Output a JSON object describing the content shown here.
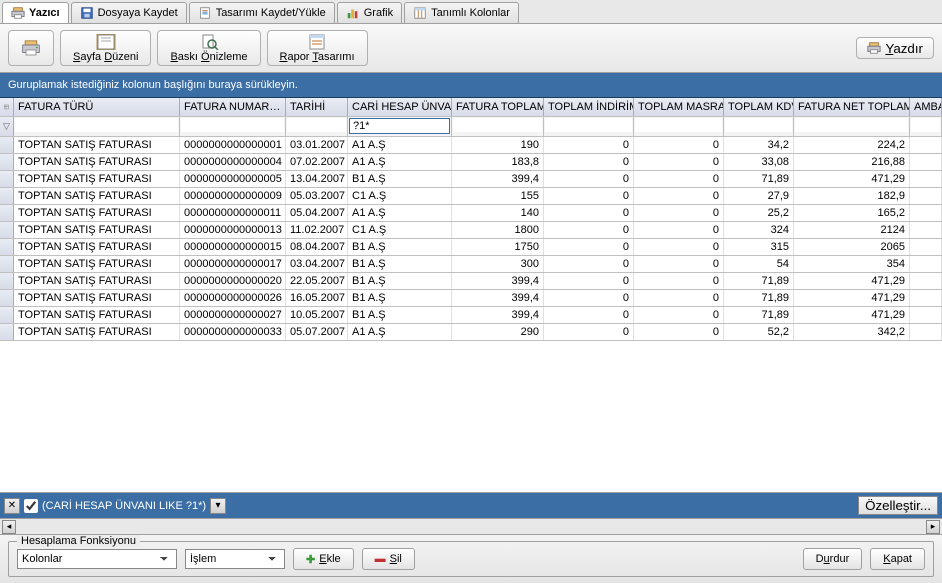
{
  "tabs": [
    {
      "label": "Yazıcı",
      "icon": "printer"
    },
    {
      "label": "Dosyaya Kaydet",
      "icon": "save"
    },
    {
      "label": "Tasarımı Kaydet/Yükle",
      "icon": "report"
    },
    {
      "label": "Grafik",
      "icon": "chart"
    },
    {
      "label": "Tanımlı Kolonlar",
      "icon": "columns"
    }
  ],
  "toolbar": {
    "print_icon": "printer",
    "page_layout": "Sayfa Düzeni",
    "preview": "Baskı Önizleme",
    "report_design": "Rapor Tasarımı",
    "print_btn": "Yazdır"
  },
  "group_text": "Guruplamak istediğiniz kolonun başlığını buraya sürükleyin.",
  "columns": [
    "FATURA TÜRÜ",
    "FATURA NUMAR…",
    "TARİHİ",
    "CARİ HESAP ÜNVANI",
    "FATURA TOPLAMI",
    "TOPLAM İNDİRİM",
    "TOPLAM MASRAF",
    "TOPLAM KDV",
    "FATURA NET TOPLAMI",
    "AMBA"
  ],
  "filter_values": {
    "cari": "?1*"
  },
  "rows": [
    {
      "type": "TOPTAN SATIŞ FATURASI",
      "num": "0000000000000001",
      "date": "03.01.2007",
      "cari": "A1 A.Ş",
      "tot": "190",
      "ind": "0",
      "mas": "0",
      "kdv": "34,2",
      "net": "224,2"
    },
    {
      "type": "TOPTAN SATIŞ FATURASI",
      "num": "0000000000000004",
      "date": "07.02.2007",
      "cari": "A1 A.Ş",
      "tot": "183,8",
      "ind": "0",
      "mas": "0",
      "kdv": "33,08",
      "net": "216,88"
    },
    {
      "type": "TOPTAN SATIŞ FATURASI",
      "num": "0000000000000005",
      "date": "13.04.2007",
      "cari": "B1 A.Ş",
      "tot": "399,4",
      "ind": "0",
      "mas": "0",
      "kdv": "71,89",
      "net": "471,29"
    },
    {
      "type": "TOPTAN SATIŞ FATURASI",
      "num": "0000000000000009",
      "date": "05.03.2007",
      "cari": "C1 A.Ş",
      "tot": "155",
      "ind": "0",
      "mas": "0",
      "kdv": "27,9",
      "net": "182,9"
    },
    {
      "type": "TOPTAN SATIŞ FATURASI",
      "num": "0000000000000011",
      "date": "05.04.2007",
      "cari": "A1 A.Ş",
      "tot": "140",
      "ind": "0",
      "mas": "0",
      "kdv": "25,2",
      "net": "165,2"
    },
    {
      "type": "TOPTAN SATIŞ FATURASI",
      "num": "0000000000000013",
      "date": "11.02.2007",
      "cari": "C1 A.Ş",
      "tot": "1800",
      "ind": "0",
      "mas": "0",
      "kdv": "324",
      "net": "2124"
    },
    {
      "type": "TOPTAN SATIŞ FATURASI",
      "num": "0000000000000015",
      "date": "08.04.2007",
      "cari": "B1 A.Ş",
      "tot": "1750",
      "ind": "0",
      "mas": "0",
      "kdv": "315",
      "net": "2065"
    },
    {
      "type": "TOPTAN SATIŞ FATURASI",
      "num": "0000000000000017",
      "date": "03.04.2007",
      "cari": "B1 A.Ş",
      "tot": "300",
      "ind": "0",
      "mas": "0",
      "kdv": "54",
      "net": "354"
    },
    {
      "type": "TOPTAN SATIŞ FATURASI",
      "num": "0000000000000020",
      "date": "22.05.2007",
      "cari": "B1 A.Ş",
      "tot": "399,4",
      "ind": "0",
      "mas": "0",
      "kdv": "71,89",
      "net": "471,29"
    },
    {
      "type": "TOPTAN SATIŞ FATURASI",
      "num": "0000000000000026",
      "date": "16.05.2007",
      "cari": "B1 A.Ş",
      "tot": "399,4",
      "ind": "0",
      "mas": "0",
      "kdv": "71,89",
      "net": "471,29"
    },
    {
      "type": "TOPTAN SATIŞ FATURASI",
      "num": "0000000000000027",
      "date": "10.05.2007",
      "cari": "B1 A.Ş",
      "tot": "399,4",
      "ind": "0",
      "mas": "0",
      "kdv": "71,89",
      "net": "471,29"
    },
    {
      "type": "TOPTAN SATIŞ FATURASI",
      "num": "0000000000000033",
      "date": "05.07.2007",
      "cari": "A1 A.Ş",
      "tot": "290",
      "ind": "0",
      "mas": "0",
      "kdv": "52,2",
      "net": "342,2"
    }
  ],
  "filter_strip": {
    "expr": "(CARİ HESAP ÜNVANI LIKE ?1*)",
    "customize": "Özelleştir..."
  },
  "footer": {
    "legend": "Hesaplama Fonksiyonu",
    "sel_columns": "Kolonlar",
    "sel_operation": "İşlem",
    "add": "Ekle",
    "del": "Sil",
    "stop": "Durdur",
    "close": "Kapat"
  }
}
